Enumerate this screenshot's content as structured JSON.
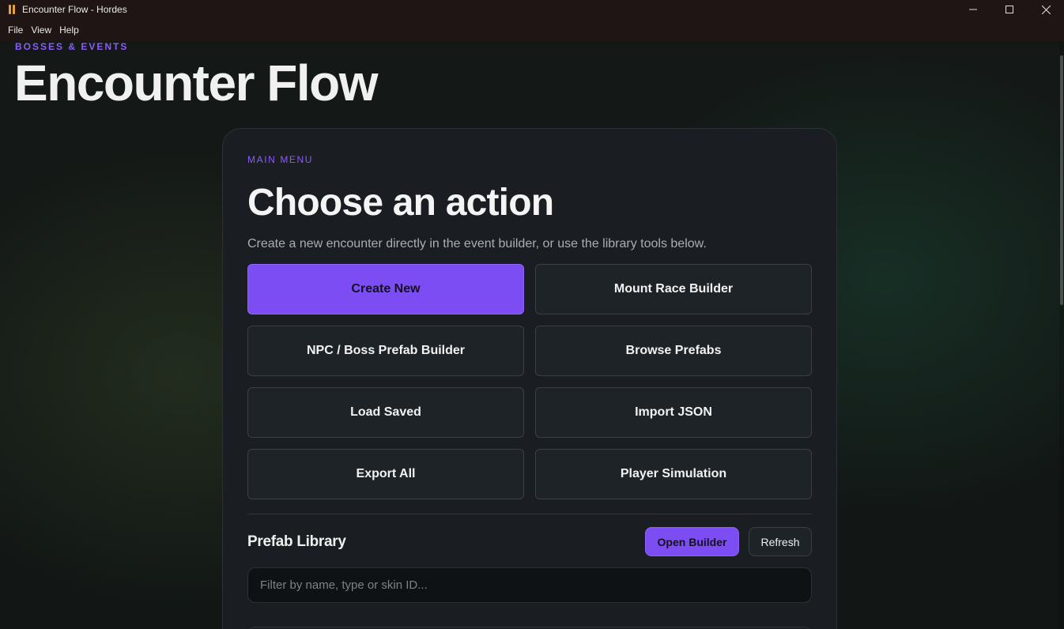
{
  "window": {
    "title": "Encounter Flow - Hordes",
    "controls": [
      "minimize-icon",
      "maximize-icon",
      "close-icon"
    ]
  },
  "menubar": {
    "items": [
      "File",
      "View",
      "Help"
    ]
  },
  "header": {
    "eyebrow": "BOSSES & EVENTS",
    "title": "Encounter Flow"
  },
  "main_menu": {
    "eyebrow": "MAIN MENU",
    "title": "Choose an action",
    "subtitle": "Create a new encounter directly in the event builder, or use the library tools below.",
    "actions": [
      {
        "label": "Create New",
        "primary": true
      },
      {
        "label": "Mount Race Builder",
        "primary": false
      },
      {
        "label": "NPC / Boss Prefab Builder",
        "primary": false
      },
      {
        "label": "Browse Prefabs",
        "primary": false
      },
      {
        "label": "Load Saved",
        "primary": false
      },
      {
        "label": "Import JSON",
        "primary": false
      },
      {
        "label": "Export All",
        "primary": false
      },
      {
        "label": "Player Simulation",
        "primary": false
      }
    ]
  },
  "prefab_library": {
    "title": "Prefab Library",
    "open_builder_label": "Open Builder",
    "refresh_label": "Refresh",
    "filter_placeholder": "Filter by name, type or skin ID...",
    "filter_value": ""
  },
  "colors": {
    "accent": "#7c4df2",
    "accent_text": "#8b5cf6",
    "card_bg": "#1a1e22",
    "titlebar_bg": "#1e1514"
  }
}
